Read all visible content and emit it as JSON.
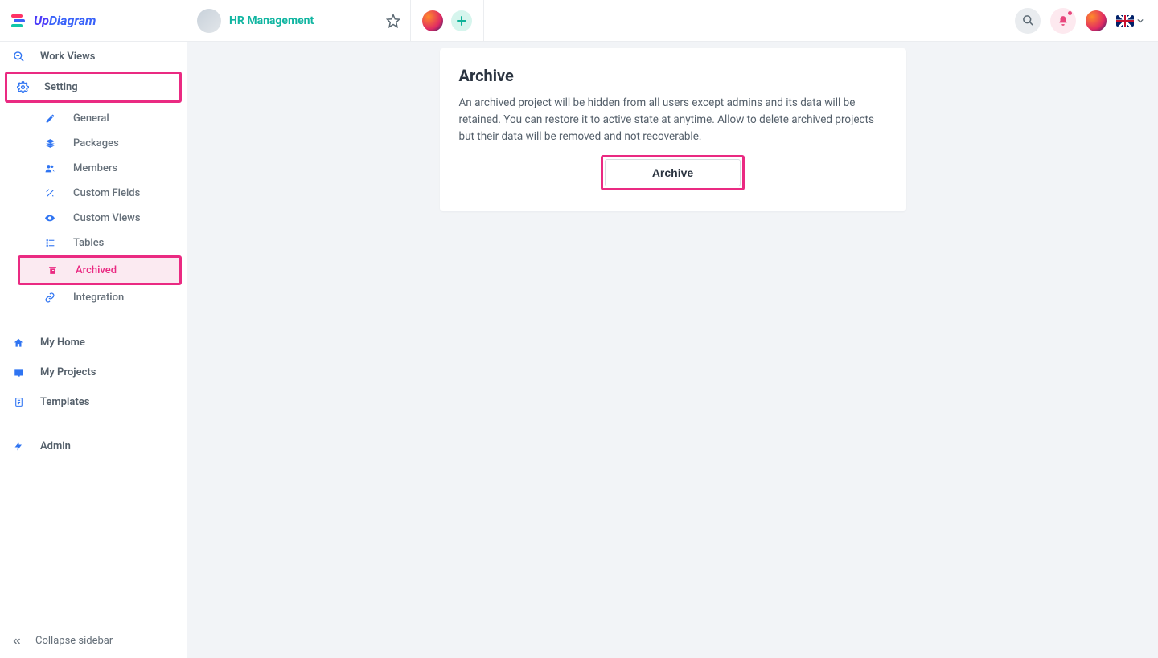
{
  "brand": {
    "prefix": "Up",
    "suffix": "Diagram"
  },
  "header": {
    "project_name": "HR Management",
    "language": "English (UK)"
  },
  "sidebar": {
    "work_views": "Work Views",
    "setting": "Setting",
    "setting_items": {
      "general": "General",
      "packages": "Packages",
      "members": "Members",
      "custom_fields": "Custom Fields",
      "custom_views": "Custom Views",
      "tables": "Tables",
      "archived": "Archived",
      "integration": "Integration"
    },
    "my_home": "My Home",
    "my_projects": "My Projects",
    "templates": "Templates",
    "admin": "Admin",
    "collapse": "Collapse sidebar"
  },
  "archive": {
    "title": "Archive",
    "description": "An archived project will be hidden from all users except admins and its data will be retained. You can restore it to active state at anytime. Allow to delete archived projects but their data will be removed and not recoverable.",
    "button": "Archive"
  }
}
